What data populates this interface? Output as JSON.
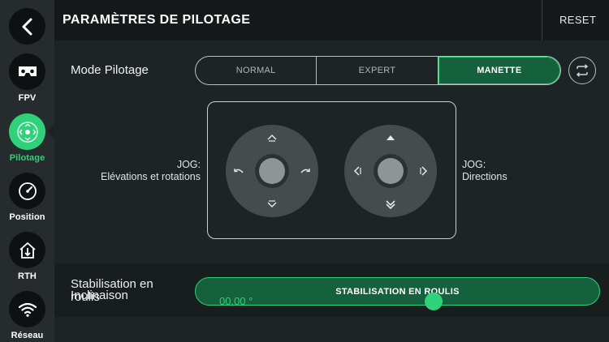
{
  "header": {
    "title": "PARAMÈTRES DE PILOTAGE",
    "reset_label": "RESET"
  },
  "sidebar": {
    "back_icon": "chevron-left-icon",
    "items": [
      {
        "label": "FPV",
        "icon": "vr-headset-icon",
        "active": false
      },
      {
        "label": "Pilotage",
        "icon": "joystick-icon",
        "active": true
      },
      {
        "label": "Position",
        "icon": "gauge-icon",
        "active": false
      },
      {
        "label": "RTH",
        "icon": "home-arrow-icon",
        "active": false
      },
      {
        "label": "Réseau",
        "icon": "wifi-icon",
        "active": false
      }
    ]
  },
  "pilot_mode": {
    "label": "Mode Pilotage",
    "options": [
      "NORMAL",
      "EXPERT",
      "MANETTE"
    ],
    "selected": "MANETTE",
    "swap_icon": "swap-arrows-icon"
  },
  "jog": {
    "left_title": "JOG:",
    "left_desc": "Elévations et rotations",
    "right_title": "JOG:",
    "right_desc": "Directions"
  },
  "stabilisation": {
    "label": "Stabilisation en roulis",
    "button_label": "STABILISATION EN ROULIS"
  },
  "inclinaison": {
    "label": "Inclinaison",
    "value": "00,00 °"
  },
  "colors": {
    "accent": "#2fd17a",
    "accent_dark": "#15603d",
    "background": "#1e2425"
  }
}
